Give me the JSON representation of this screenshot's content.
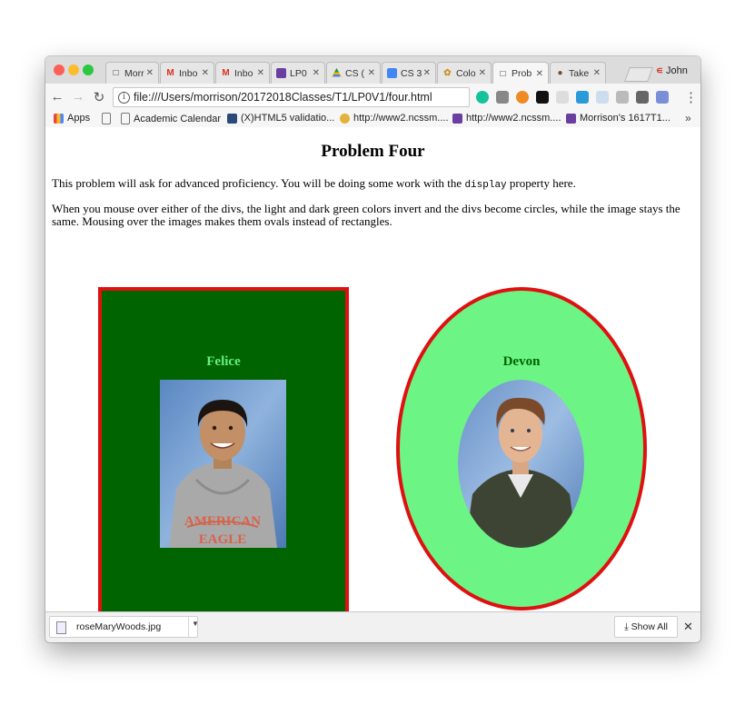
{
  "browser": {
    "tabs": [
      {
        "label": "Morr",
        "icon": "page"
      },
      {
        "label": "Inbo",
        "icon": "gmail"
      },
      {
        "label": "Inbo",
        "icon": "gmail"
      },
      {
        "label": "LP0",
        "icon": "purple-app"
      },
      {
        "label": "CS (",
        "icon": "drive"
      },
      {
        "label": "CS 3",
        "icon": "docs"
      },
      {
        "label": "Colo",
        "icon": "color"
      },
      {
        "label": "Prob",
        "icon": "page"
      },
      {
        "label": "Take",
        "icon": "avatar"
      }
    ],
    "active_tab_index": 7,
    "profile_name": "John",
    "url": "file:///Users/morrison/20172018Classes/T1/LP0V1/four.html",
    "bookmarks": [
      {
        "label": "Apps"
      },
      {
        "label": ""
      },
      {
        "label": "Academic Calendar"
      },
      {
        "label": "(X)HTML5 validatio..."
      },
      {
        "label": "http://www2.ncssm...."
      },
      {
        "label": "http://www2.ncssm...."
      },
      {
        "label": "Morrison's 1617T1..."
      }
    ]
  },
  "page": {
    "title": "Problem Four",
    "para1_before": "This problem will ask for advanced proficiency. You will be doing some work with the ",
    "para1_code": "display",
    "para1_after": " property here.",
    "para2": "When you mouse over either of the divs, the light and dark green colors invert and the divs become circles, while the image stays the same. Mousing over the images makes them ovals instead of rectangles.",
    "cards": [
      {
        "name": "Felice",
        "shape": "rectangle"
      },
      {
        "name": "Devon",
        "shape": "circle"
      }
    ],
    "photo_hoodie_text": [
      "AMERICAN",
      "EAGLE"
    ]
  },
  "colors": {
    "dark_green": "#006400",
    "light_green": "#6cf585",
    "border_red": "#e01010"
  },
  "download_shelf": {
    "file_name": "roseMaryWoods.jpg",
    "show_all_label": "Show All"
  }
}
